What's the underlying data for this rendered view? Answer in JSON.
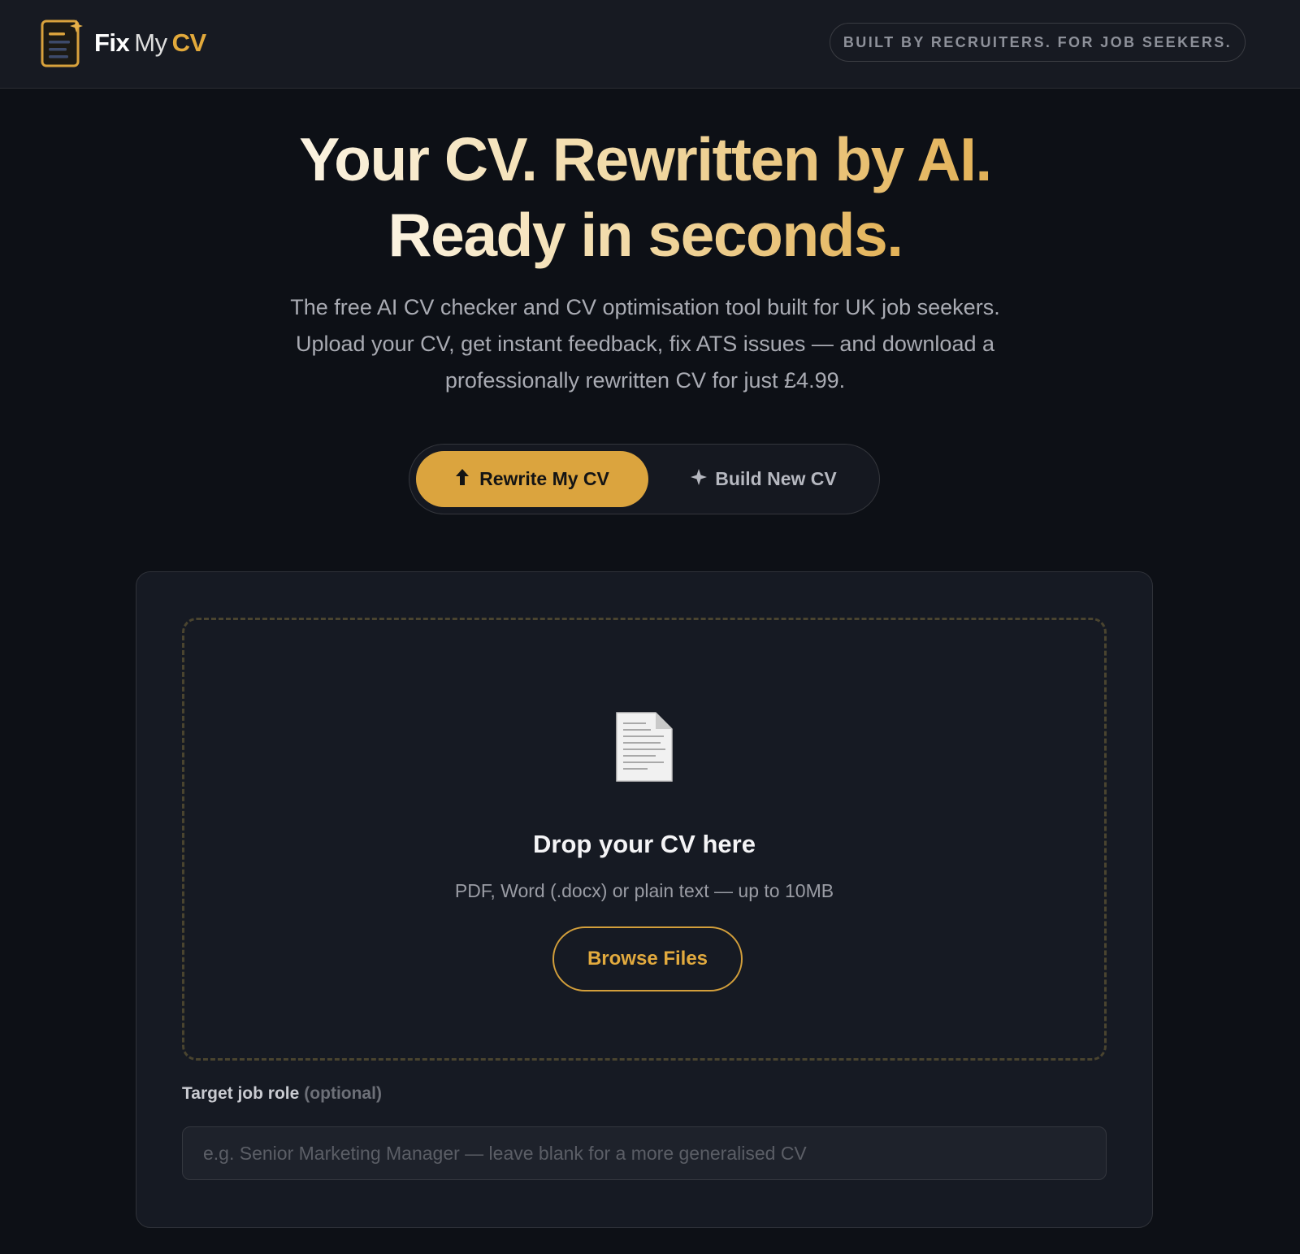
{
  "header": {
    "logo": {
      "fix": "Fix",
      "my": "My",
      "cv": "CV"
    },
    "badge": "BUILT BY RECRUITERS. FOR JOB SEEKERS."
  },
  "hero": {
    "title_line1": "Your CV. Rewritten by AI.",
    "title_line2": "Ready in seconds.",
    "subtitle_line1": "The free AI CV checker and CV optimisation tool built for UK job seekers.",
    "subtitle_line2": "Upload your CV, get instant feedback, fix ATS issues — and download a",
    "subtitle_line3": "professionally rewritten CV for just £4.99."
  },
  "mode_toggle": {
    "rewrite_label": "Rewrite My CV",
    "rewrite_icon": "upload-arrow-icon",
    "build_label": "Build New CV",
    "build_icon": "sparkle-icon",
    "active": "rewrite"
  },
  "upload": {
    "icon": "document-icon",
    "title": "Drop your CV here",
    "subtitle": "PDF, Word (.docx) or plain text — up to 10MB",
    "browse_label": "Browse Files"
  },
  "target_role": {
    "label": "Target job role",
    "optional": "(optional)",
    "value": "",
    "placeholder": "e.g. Senior Marketing Manager — leave blank for a more generalised CV"
  },
  "colors": {
    "background": "#0d1016",
    "header": "#171a22",
    "accent": "#dba43e",
    "card": "#161a23"
  }
}
